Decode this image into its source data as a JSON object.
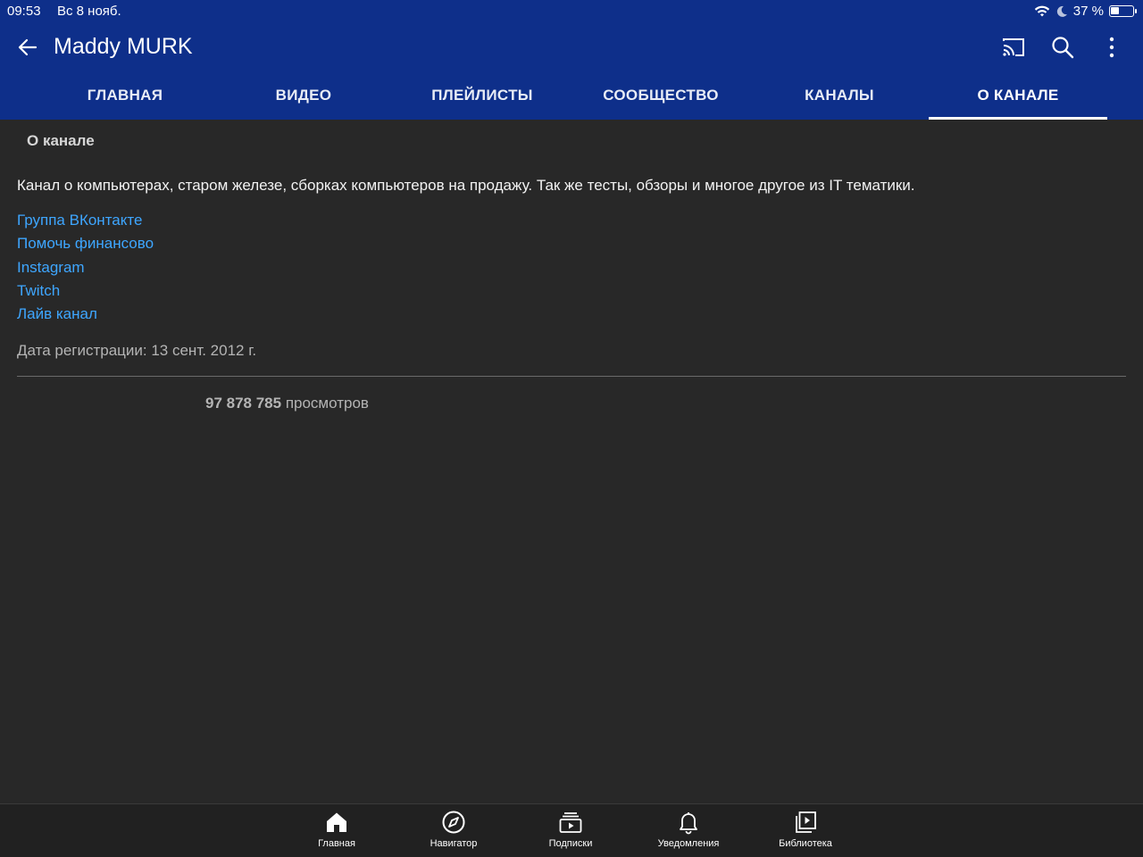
{
  "status_bar": {
    "time": "09:53",
    "date": "Вс 8 нояб.",
    "battery": "37 %",
    "battery_level": 0.37
  },
  "header": {
    "title": "Maddy MURK",
    "icons": [
      "back-arrow-icon",
      "cast-icon",
      "search-icon",
      "more-vert-icon"
    ]
  },
  "tabs": [
    {
      "label": "ГЛАВНАЯ",
      "active": false
    },
    {
      "label": "ВИДЕО",
      "active": false
    },
    {
      "label": "ПЛЕЙЛИСТЫ",
      "active": false
    },
    {
      "label": "СООБЩЕСТВО",
      "active": false
    },
    {
      "label": "КАНАЛЫ",
      "active": false
    },
    {
      "label": "О КАНАЛЕ",
      "active": true
    }
  ],
  "about": {
    "section_title": "О канале",
    "description": "Канал о компьютерах, старом железе, сборках компьютеров на продажу. Так же тесты, обзоры и многое другое из IT тематики.",
    "links": [
      "Группа ВКонтакте",
      "Помочь финансово",
      "Instagram",
      "Twitch",
      "Лайв канал"
    ],
    "registration": "Дата регистрации: 13 сент. 2012 г.",
    "views_count": "97 878 785",
    "views_label": " просмотров"
  },
  "bottom_nav": [
    {
      "label": "Главная",
      "icon": "home-icon"
    },
    {
      "label": "Навигатор",
      "icon": "compass-icon"
    },
    {
      "label": "Подписки",
      "icon": "subscriptions-icon"
    },
    {
      "label": "Уведомления",
      "icon": "bell-icon"
    },
    {
      "label": "Библиотека",
      "icon": "library-icon"
    }
  ],
  "colors": {
    "header_bg": "#0e2f8a",
    "content_bg": "#282828",
    "link": "#3ea6ff",
    "nav_bg": "#212121"
  }
}
